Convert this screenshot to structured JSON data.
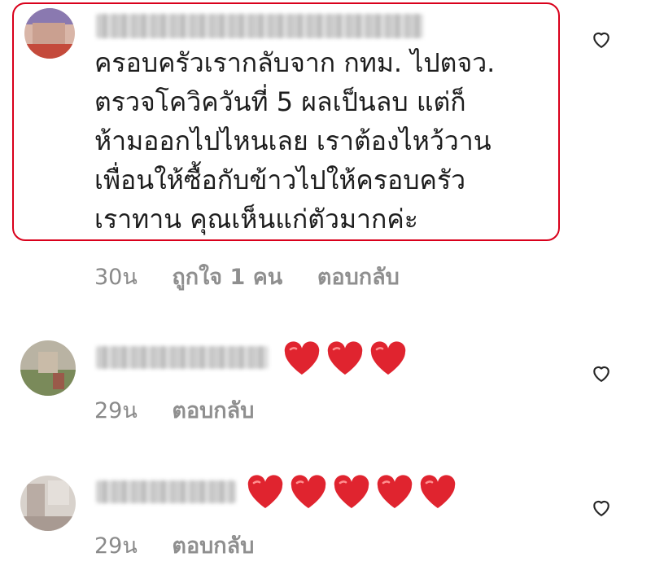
{
  "comments": [
    {
      "text": "ครอบครัวเรากลับจาก กทม. ไปตจว.\nตรวจโควิควันที่ 5 ผลเป็นลบ แต่ก็\nห้ามออกไปไหนเลย เราต้องไหว้วาน\nเพื่อนให้ซื้อกับข้าวไปให้ครอบครัว\nเราทาน คุณเห็นแก่ตัวมากค่ะ",
      "time": "30น",
      "likes": "ถูกใจ 1 คน",
      "reply": "ตอบกลับ"
    },
    {
      "hearts": 3,
      "time": "29น",
      "reply": "ตอบกลับ"
    },
    {
      "hearts": 5,
      "time": "29น",
      "reply": "ตอบกลับ"
    }
  ],
  "colors": {
    "highlight_border": "#d9001b",
    "heart": "#e0242f",
    "meta_text": "#8a8a8a"
  },
  "icons": {
    "like": "heart-outline-icon",
    "emoji": "red-heart-emoji"
  }
}
